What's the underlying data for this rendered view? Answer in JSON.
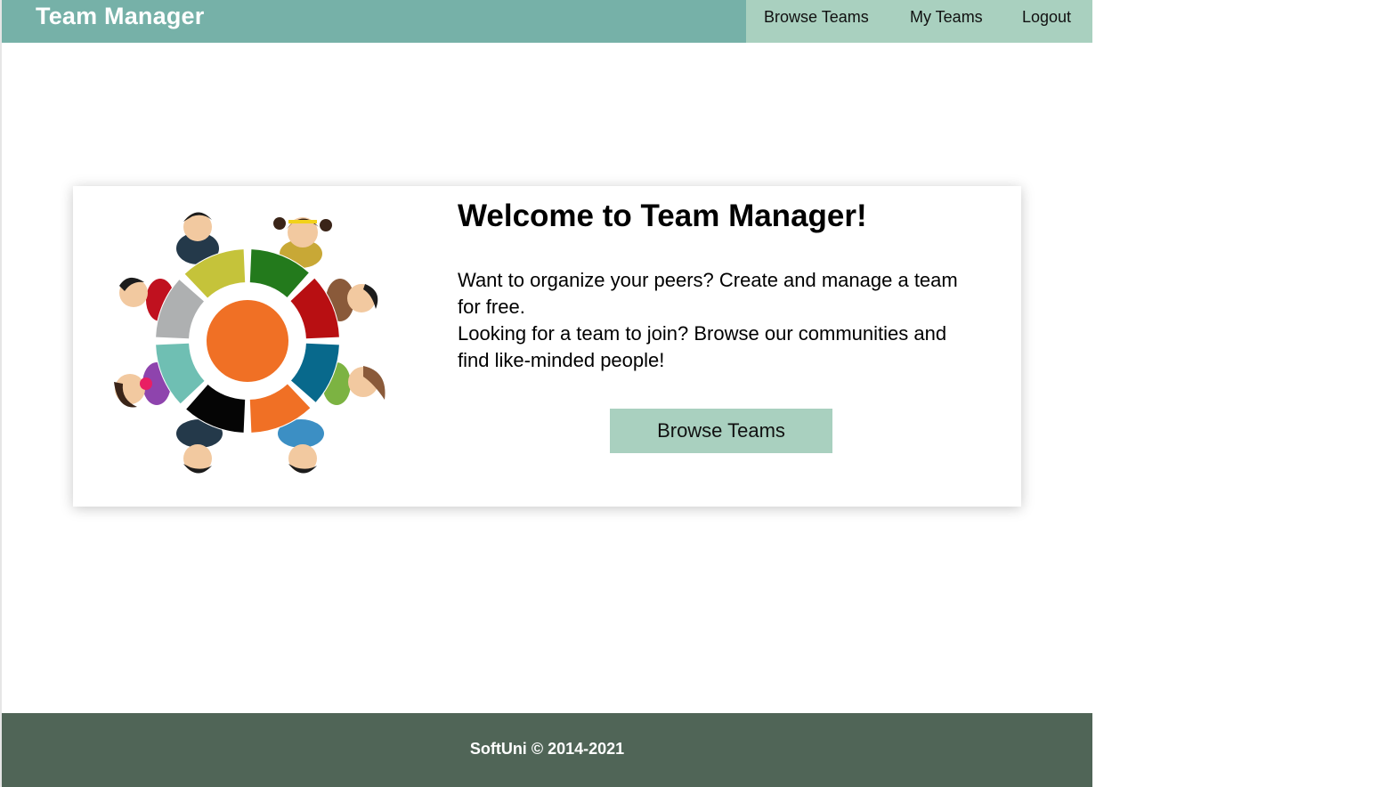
{
  "header": {
    "brand": "Team Manager",
    "nav": {
      "browse_teams": "Browse Teams",
      "my_teams": "My Teams",
      "logout": "Logout"
    }
  },
  "hero": {
    "title": "Welcome to Team Manager!",
    "paragraph_lines": [
      "Want to organize your peers? Create and manage a team for free.",
      "Looking for a team to join? Browse our communities and find like-minded people!"
    ],
    "button_label": "Browse Teams",
    "illustration": "team-circle-illustration"
  },
  "footer": {
    "copyright": "SoftUni © 2014-2021"
  },
  "colors": {
    "header_bg": "#76b1a8",
    "nav_bg": "#a9d0bf",
    "button_bg": "#a9d0bf",
    "footer_bg": "#506557",
    "center_orange": "#f07025"
  }
}
